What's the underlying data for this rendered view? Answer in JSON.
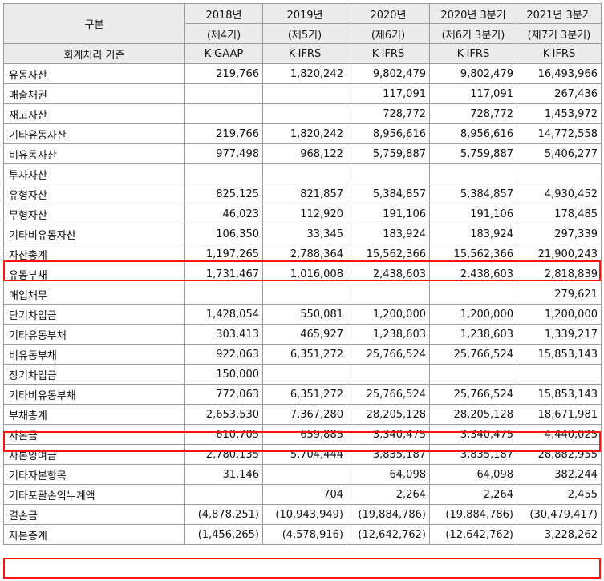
{
  "header": {
    "gubun": "구분",
    "years": [
      "2018년",
      "2019년",
      "2020년",
      "2020년 3분기",
      "2021년 3분기"
    ],
    "periods": [
      "(제4기)",
      "(제5기)",
      "(제6기)",
      "(제6기 3분기)",
      "(제7기 3분기)"
    ],
    "standard_label": "회계처리 기준",
    "standards": [
      "K-GAAP",
      "K-IFRS",
      "K-IFRS",
      "K-IFRS",
      "K-IFRS"
    ]
  },
  "rows": [
    {
      "label": "유동자산",
      "values": [
        "219,766",
        "1,820,242",
        "9,802,479",
        "9,802,479",
        "16,493,966"
      ]
    },
    {
      "label": "매출채권",
      "values": [
        "",
        "",
        "117,091",
        "117,091",
        "267,436"
      ]
    },
    {
      "label": "재고자산",
      "values": [
        "",
        "",
        "728,772",
        "728,772",
        "1,453,972"
      ]
    },
    {
      "label": "기타유동자산",
      "values": [
        "219,766",
        "1,820,242",
        "8,956,616",
        "8,956,616",
        "14,772,558"
      ]
    },
    {
      "label": "비유동자산",
      "values": [
        "977,498",
        "968,122",
        "5,759,887",
        "5,759,887",
        "5,406,277"
      ]
    },
    {
      "label": "투자자산",
      "values": [
        "",
        "",
        "",
        "",
        ""
      ]
    },
    {
      "label": "유형자산",
      "values": [
        "825,125",
        "821,857",
        "5,384,857",
        "5,384,857",
        "4,930,452"
      ]
    },
    {
      "label": "무형자산",
      "values": [
        "46,023",
        "112,920",
        "191,106",
        "191,106",
        "178,485"
      ]
    },
    {
      "label": "기타비유동자산",
      "values": [
        "106,350",
        "33,345",
        "183,924",
        "183,924",
        "297,339"
      ]
    },
    {
      "label": "자산총계",
      "values": [
        "1,197,265",
        "2,788,364",
        "15,562,366",
        "15,562,366",
        "21,900,243"
      ]
    },
    {
      "label": "유동부채",
      "values": [
        "1,731,467",
        "1,016,008",
        "2,438,603",
        "2,438,603",
        "2,818,839"
      ]
    },
    {
      "label": "매입채무",
      "values": [
        "",
        "",
        "",
        "",
        "279,621"
      ]
    },
    {
      "label": "단기차입금",
      "values": [
        "1,428,054",
        "550,081",
        "1,200,000",
        "1,200,000",
        "1,200,000"
      ]
    },
    {
      "label": "기타유동부채",
      "values": [
        "303,413",
        "465,927",
        "1,238,603",
        "1,238,603",
        "1,339,217"
      ]
    },
    {
      "label": "비유동부채",
      "values": [
        "922,063",
        "6,351,272",
        "25,766,524",
        "25,766,524",
        "15,853,143"
      ]
    },
    {
      "label": "장기차입금",
      "values": [
        "150,000",
        "",
        "",
        "",
        ""
      ]
    },
    {
      "label": "기타비유동부채",
      "values": [
        "772,063",
        "6,351,272",
        "25,766,524",
        "25,766,524",
        "15,853,143"
      ]
    },
    {
      "label": "부채총계",
      "values": [
        "2,653,530",
        "7,367,280",
        "28,205,128",
        "28,205,128",
        "18,671,981"
      ]
    },
    {
      "label": "자본금",
      "values": [
        "610,705",
        "659,885",
        "3,340,475",
        "3,340,475",
        "4,440,025"
      ]
    },
    {
      "label": "자본잉여금",
      "values": [
        "2,780,135",
        "5,704,444",
        "3,835,187",
        "3,835,187",
        "28,882,955"
      ]
    },
    {
      "label": "기타자본항목",
      "values": [
        "31,146",
        "",
        "64,098",
        "64,098",
        "382,244"
      ]
    },
    {
      "label": "기타포괄손익누계액",
      "values": [
        "",
        "704",
        "2,264",
        "2,264",
        "2,455"
      ]
    },
    {
      "label": "결손금",
      "values": [
        "(4,878,251)",
        "(10,943,949)",
        "(19,884,786)",
        "(19,884,786)",
        "(30,479,417)"
      ]
    },
    {
      "label": "자본총계",
      "values": [
        "(1,456,265)",
        "(4,578,916)",
        "(12,642,762)",
        "(12,642,762)",
        "3,228,262"
      ]
    }
  ],
  "highlight_color": "#ff1414"
}
